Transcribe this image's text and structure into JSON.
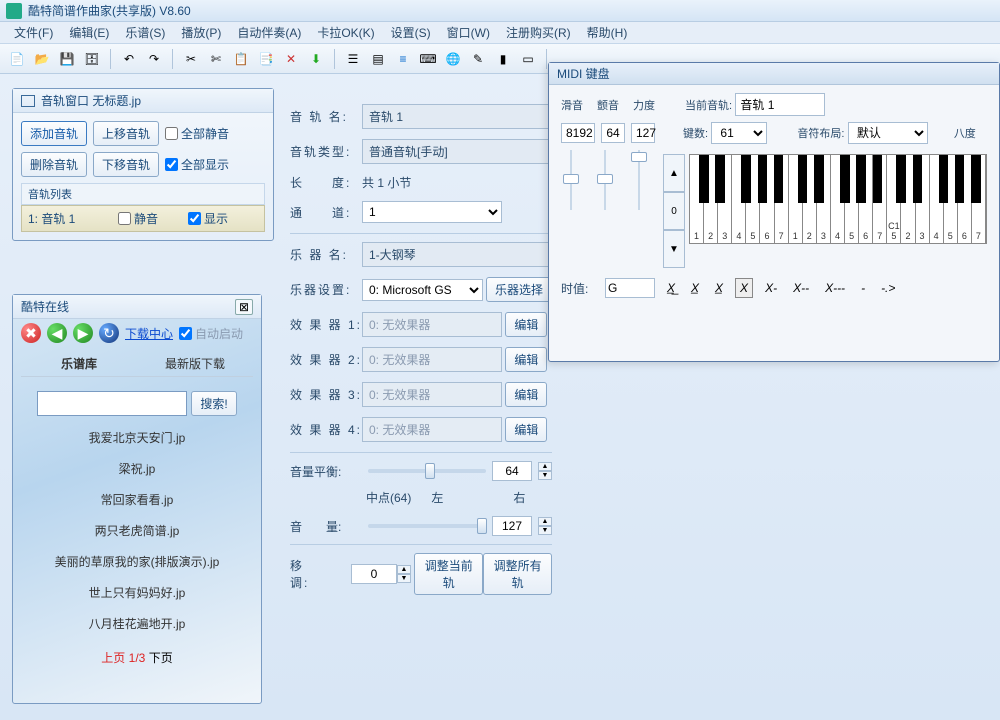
{
  "app": {
    "title": "酷特简谱作曲家(共享版) V8.60"
  },
  "menu": [
    "文件(F)",
    "编辑(E)",
    "乐谱(S)",
    "播放(P)",
    "自动伴奏(A)",
    "卡拉OK(K)",
    "设置(S)",
    "窗口(W)",
    "注册购买(R)",
    "帮助(H)"
  ],
  "track_window": {
    "title": "音轨窗口  无标题.jp",
    "btn_add": "添加音轨",
    "btn_del": "删除音轨",
    "btn_up": "上移音轨",
    "btn_down": "下移音轨",
    "chk_all_mute": "全部静音",
    "chk_all_show": "全部显示",
    "list_header": "音轨列表",
    "row": {
      "name": "1: 音轨 1",
      "mute": "静音",
      "show": "显示"
    }
  },
  "online": {
    "title": "酷特在线",
    "download_center": "下载中心",
    "auto_start": "自动启动",
    "tab1": "乐谱库",
    "tab2": "最新版下载",
    "search_btn": "搜索!",
    "scores": [
      "我爱北京天安门.jp",
      "梁祝.jp",
      "常回家看看.jp",
      "两只老虎简谱.jp",
      "美丽的草原我的家(排版演示).jp",
      "世上只有妈妈好.jp",
      "八月桂花遍地开.jp"
    ],
    "pager_prev": "上页",
    "pager_cur": "1/3",
    "pager_next": "下页"
  },
  "props": {
    "track_name_lbl": "音 轨 名:",
    "track_name": "音轨 1",
    "track_type_lbl": "音轨类型:",
    "track_type": "普通音轨[手动]",
    "length_lbl": "长　　度:",
    "length": "共 1 小节",
    "channel_lbl": "通　　道:",
    "channel": "1",
    "instr_name_lbl": "乐 器 名:",
    "instr_name": "1-大钢琴",
    "instr_dev_lbl": "乐器设置:",
    "instr_dev": "0: Microsoft GS",
    "instr_select": "乐器选择",
    "fx1_lbl": "效 果 器 1:",
    "fx2_lbl": "效 果 器 2:",
    "fx3_lbl": "效 果 器 3:",
    "fx4_lbl": "效 果 器 4:",
    "fx_none": "0: 无效果器",
    "edit": "编辑",
    "balance_lbl": "音量平衡:",
    "balance_val": "64",
    "mid_lbl": "中点(64)",
    "left": "左",
    "right": "右",
    "volume_lbl": "音　　量:",
    "volume_val": "127",
    "transpose_lbl": "移　　调:",
    "transpose_val": "0",
    "adjust_cur": "调整当前轨",
    "adjust_all": "调整所有轨"
  },
  "midi": {
    "title": "MIDI 键盘",
    "glide": "滑音",
    "tremolo": "颤音",
    "velocity": "力度",
    "glide_val": "8192",
    "tremolo_val": "64",
    "velocity_val": "127",
    "cur_track_lbl": "当前音轨:",
    "cur_track": "音轨 1",
    "keys_lbl": "键数:",
    "keys": "61",
    "layout_lbl": "音符布局:",
    "layout": "默认",
    "octave_lbl": "八度",
    "octave": "0",
    "duration_lbl": "时值:",
    "duration": "G",
    "dur_btns": [
      "X̲̲",
      "X̲",
      "X̲",
      "X",
      "X-",
      "X--",
      "X---",
      "-",
      "-.>"
    ],
    "white_key_labels": [
      "1",
      "2",
      "3",
      "4",
      "5",
      "6",
      "7",
      "1",
      "2",
      "3",
      "4",
      "5",
      "6",
      "7",
      "C1 5",
      "2",
      "3",
      "4",
      "5",
      "6",
      "7"
    ]
  }
}
